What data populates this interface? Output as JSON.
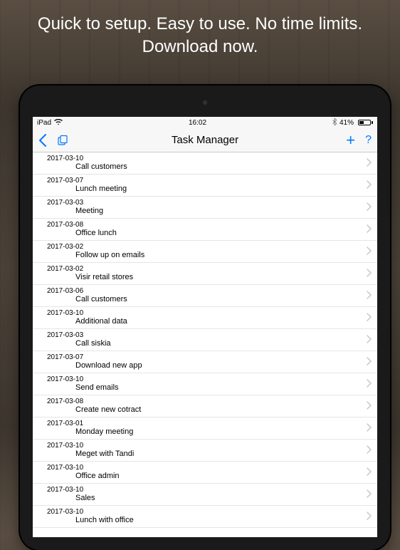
{
  "promo": "Quick to setup. Easy to use. No time limits. Download now.",
  "statusBar": {
    "carrier": "iPad",
    "time": "16:02",
    "batteryPercent": "41%"
  },
  "nav": {
    "title": "Task Manager"
  },
  "tasks": [
    {
      "date": "2017-03-10",
      "title": "Call customers"
    },
    {
      "date": "2017-03-07",
      "title": "Lunch meeting"
    },
    {
      "date": "2017-03-03",
      "title": "Meeting"
    },
    {
      "date": "2017-03-08",
      "title": "Office lunch"
    },
    {
      "date": "2017-03-02",
      "title": "Follow up on emails"
    },
    {
      "date": "2017-03-02",
      "title": "Visir retail stores"
    },
    {
      "date": "2017-03-06",
      "title": "Call customers"
    },
    {
      "date": "2017-03-10",
      "title": "Additional data"
    },
    {
      "date": "2017-03-03",
      "title": "Call siskia"
    },
    {
      "date": "2017-03-07",
      "title": "Download new app"
    },
    {
      "date": "2017-03-10",
      "title": "Send emails"
    },
    {
      "date": "2017-03-08",
      "title": "Create new cotract"
    },
    {
      "date": "2017-03-01",
      "title": "Monday meeting"
    },
    {
      "date": "2017-03-10",
      "title": "Meget with Tandi"
    },
    {
      "date": "2017-03-10",
      "title": "Office admin"
    },
    {
      "date": "2017-03-10",
      "title": "Sales"
    },
    {
      "date": "2017-03-10",
      "title": "Lunch with office"
    }
  ]
}
